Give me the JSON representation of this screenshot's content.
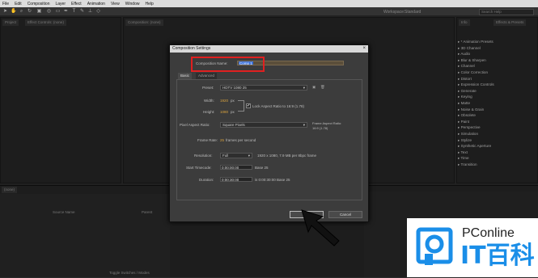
{
  "menubar": {
    "items": [
      "File",
      "Edit",
      "Composition",
      "Layer",
      "Effect",
      "Animation",
      "View",
      "Window",
      "Help"
    ]
  },
  "toolbar": {
    "workspace_label": "Workspace:",
    "workspace_name": "Standard",
    "search_placeholder": "Search Help"
  },
  "panels": {
    "project_tab": "Project",
    "effects_controls_tab": "Effect Controls: (none)",
    "composition_tab": "Composition: (none)",
    "effects_presets_tab": "Effects & Presets",
    "info_tab": "Info"
  },
  "effects": {
    "items": [
      "* Animation Presets",
      "3D Channel",
      "Audio",
      "Blur & Sharpen",
      "Channel",
      "Color Correction",
      "Distort",
      "Expression Controls",
      "Generate",
      "Keying",
      "Matte",
      "Noise & Grain",
      "Obsolete",
      "Paint",
      "Perspective",
      "Simulation",
      "Stylize",
      "Synthetic Aperture",
      "Text",
      "Time",
      "Transition"
    ]
  },
  "timeline": {
    "tab": "(none)",
    "source_name_header": "Source Name",
    "parent_header": "Parent",
    "toggle_label": "Toggle Switches / Modes"
  },
  "dialog": {
    "title": "Composition Settings",
    "close_icon": "×",
    "comp_name_label": "Composition Name:",
    "comp_name_value": "Comp 1",
    "tabs": [
      "Basic",
      "Advanced"
    ],
    "preset_label": "Preset:",
    "preset_value": "HDTV 1080 25",
    "width_label": "Width:",
    "width_value": "1920",
    "width_unit": "px",
    "height_label": "Height:",
    "height_value": "1080",
    "height_unit": "px",
    "lock_aspect_label": "Lock Aspect Ratio to 16:9 (1.78)",
    "pixel_aspect_label": "Pixel Aspect Ratio:",
    "pixel_aspect_value": "Square Pixels",
    "frame_aspect_label": "Frame Aspect Ratio:",
    "frame_aspect_value": "16:9 (1.78)",
    "frame_rate_label": "Frame Rate:",
    "frame_rate_value": "25",
    "frame_rate_unit": "frames per second",
    "resolution_label": "Resolution:",
    "resolution_value": "Full",
    "resolution_info": "1920 x 1080, 7.9 MB per 8bpc frame",
    "start_timecode_label": "Start Timecode:",
    "start_timecode_value": "0:00:00:00",
    "start_timecode_base": "Base 25",
    "duration_label": "Duration:",
    "duration_value": "0:00:30:00",
    "duration_info": "is 0:00:30:00  Base 25",
    "ok_label": "OK",
    "cancel_label": "Cancel"
  },
  "logo": {
    "text_top": "PConline",
    "text_bottom": "IT百科"
  },
  "colors": {
    "accent_red": "#e02020",
    "value_orange": "#d9a23d",
    "logo_blue": "#1a8ee8"
  }
}
